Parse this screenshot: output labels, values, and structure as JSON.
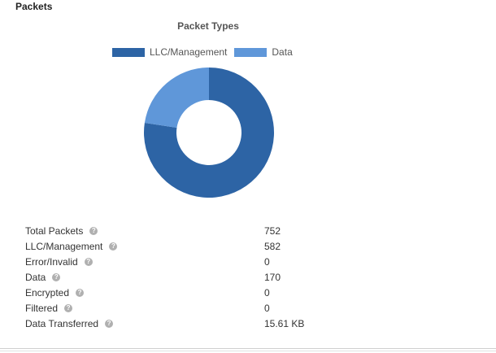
{
  "panel": {
    "title": "Packets"
  },
  "chart_data": {
    "type": "pie",
    "title": "Packet Types",
    "categories": [
      "LLC/Management",
      "Data"
    ],
    "values": [
      582,
      170
    ],
    "colors": [
      "#2d64a5",
      "#5f97d9"
    ],
    "legend_position": "top",
    "hole": "donut"
  },
  "stats": [
    {
      "label": "Total Packets",
      "value": "752"
    },
    {
      "label": "LLC/Management",
      "value": "582"
    },
    {
      "label": "Error/Invalid",
      "value": "0"
    },
    {
      "label": "Data",
      "value": "170"
    },
    {
      "label": "Encrypted",
      "value": "0"
    },
    {
      "label": "Filtered",
      "value": "0"
    },
    {
      "label": "Data Transferred",
      "value": "15.61 KB"
    }
  ],
  "icons": {
    "help": "help-icon",
    "help_glyph": "?"
  }
}
